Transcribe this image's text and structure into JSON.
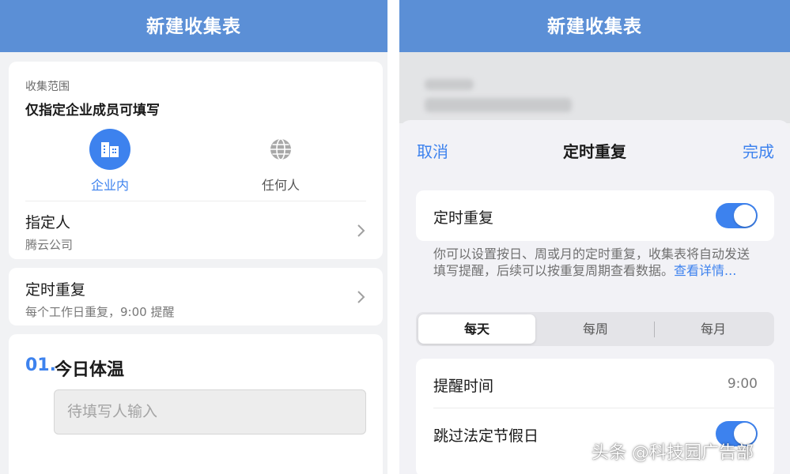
{
  "left": {
    "header_title": "新建收集表",
    "scope": {
      "label": "收集范围",
      "value": "仅指定企业成员可填写",
      "options": [
        {
          "label": "企业内",
          "selected": true,
          "icon": "building-icon"
        },
        {
          "label": "任何人",
          "selected": false,
          "icon": "globe-icon"
        }
      ],
      "assignee_title": "指定人",
      "assignee_value": "腾云公司"
    },
    "repeat": {
      "title": "定时重复",
      "summary": "每个工作日重复，9:00 提醒"
    },
    "question": {
      "number": "01.",
      "title": "今日体温",
      "placeholder": "待填写人输入"
    }
  },
  "right": {
    "header_title": "新建收集表",
    "sheet": {
      "cancel": "取消",
      "title": "定时重复",
      "done": "完成",
      "repeat_toggle_label": "定时重复",
      "repeat_toggle_on": true,
      "description": "你可以设置按日、周或月的定时重复，收集表将自动发送填写提醒，后续可以按重复周期查看数据。",
      "description_link": "查看详情...",
      "segments": [
        "每天",
        "每周",
        "每月"
      ],
      "active_segment": "每天",
      "remind_label": "提醒时间",
      "remind_value": "9:00",
      "skip_holiday_label": "跳过法定节假日",
      "skip_holiday_on": true
    }
  },
  "watermark": "头条 @科技园广告部",
  "colors": {
    "header": "#5b8fd6",
    "accent": "#3d82ee",
    "background": "#f1f2f4"
  }
}
